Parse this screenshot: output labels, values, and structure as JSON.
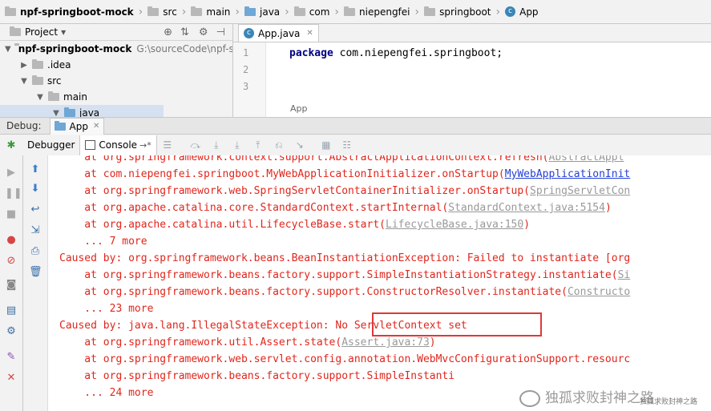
{
  "breadcrumb": {
    "project": "npf-springboot-mock",
    "items": [
      "src",
      "main",
      "java",
      "com",
      "niepengfei",
      "springboot",
      "App"
    ]
  },
  "project_panel": {
    "title": "Project",
    "dropdown": "▾",
    "root_name": "npf-springboot-mock",
    "root_path": "G:\\sourceCode\\npf-spring",
    "idea": ".idea",
    "src": "src",
    "main": "main",
    "java": "java"
  },
  "editor": {
    "tab_label": "App.java",
    "line_numbers": [
      "1",
      "2",
      "3"
    ],
    "code_keyword": "package",
    "code_rest": " com.niepengfei.springboot;",
    "footer_label": "App"
  },
  "debug_bar": {
    "label": "Debug:",
    "tab_label": "App"
  },
  "tool_tabs": {
    "debugger": "Debugger",
    "console": "Console",
    "console_arrow": "→*"
  },
  "console": {
    "lines": [
      {
        "pre": "    at org.springframework.context.support.AbstractApplicationContext.refresh(",
        "link": "AbstractAppl",
        "style": "grey",
        "post": ""
      },
      {
        "pre": "    at com.niepengfei.springboot.MyWebApplicationInitializer.onStartup(",
        "link": "MyWebApplicationInit",
        "style": "link",
        "post": ""
      },
      {
        "pre": "    at org.springframework.web.SpringServletContainerInitializer.onStartup(",
        "link": "SpringServletCon",
        "style": "grey",
        "post": ""
      },
      {
        "pre": "    at org.apache.catalina.core.StandardContext.startInternal(",
        "link": "StandardContext.java:5154",
        "style": "grey",
        "post": ")"
      },
      {
        "pre": "    at org.apache.catalina.util.LifecycleBase.start(",
        "link": "LifecycleBase.java:150",
        "style": "grey",
        "post": ")"
      },
      {
        "pre": "    ... 7 more",
        "link": "",
        "style": "",
        "post": ""
      },
      {
        "pre": "Caused by: org.springframework.beans.BeanInstantiationException: Failed to instantiate [org",
        "link": "",
        "style": "",
        "post": ""
      },
      {
        "pre": "    at org.springframework.beans.factory.support.SimpleInstantiationStrategy.instantiate(",
        "link": "Si",
        "style": "grey",
        "post": ""
      },
      {
        "pre": "    at org.springframework.beans.factory.support.ConstructorResolver.instantiate(",
        "link": "Constructo",
        "style": "grey",
        "post": ""
      },
      {
        "pre": "    ... 23 more",
        "link": "",
        "style": "",
        "post": ""
      },
      {
        "pre": "Caused by: java.lang.IllegalStateException: No ServletContext set",
        "link": "",
        "style": "",
        "post": ""
      },
      {
        "pre": "    at org.springframework.util.Assert.state(",
        "link": "Assert.java:73",
        "style": "grey",
        "post": ")"
      },
      {
        "pre": "    at org.springframework.web.servlet.config.annotation.WebMvcConfigurationSupport.resourc",
        "link": "",
        "style": "",
        "post": ""
      },
      {
        "pre": "    at org.springframework.beans.factory.support.SimpleInstanti",
        "link": "",
        "style": "",
        "post": ""
      },
      {
        "pre": "    ... 24 more",
        "link": "",
        "style": "",
        "post": ""
      }
    ]
  },
  "watermark": {
    "main": "独孤求败封神之路",
    "sub": "独孤求败封神之路"
  },
  "colors": {
    "error_text": "#e0261c",
    "link": "#2440d6",
    "highlight_box": "#e03838"
  }
}
